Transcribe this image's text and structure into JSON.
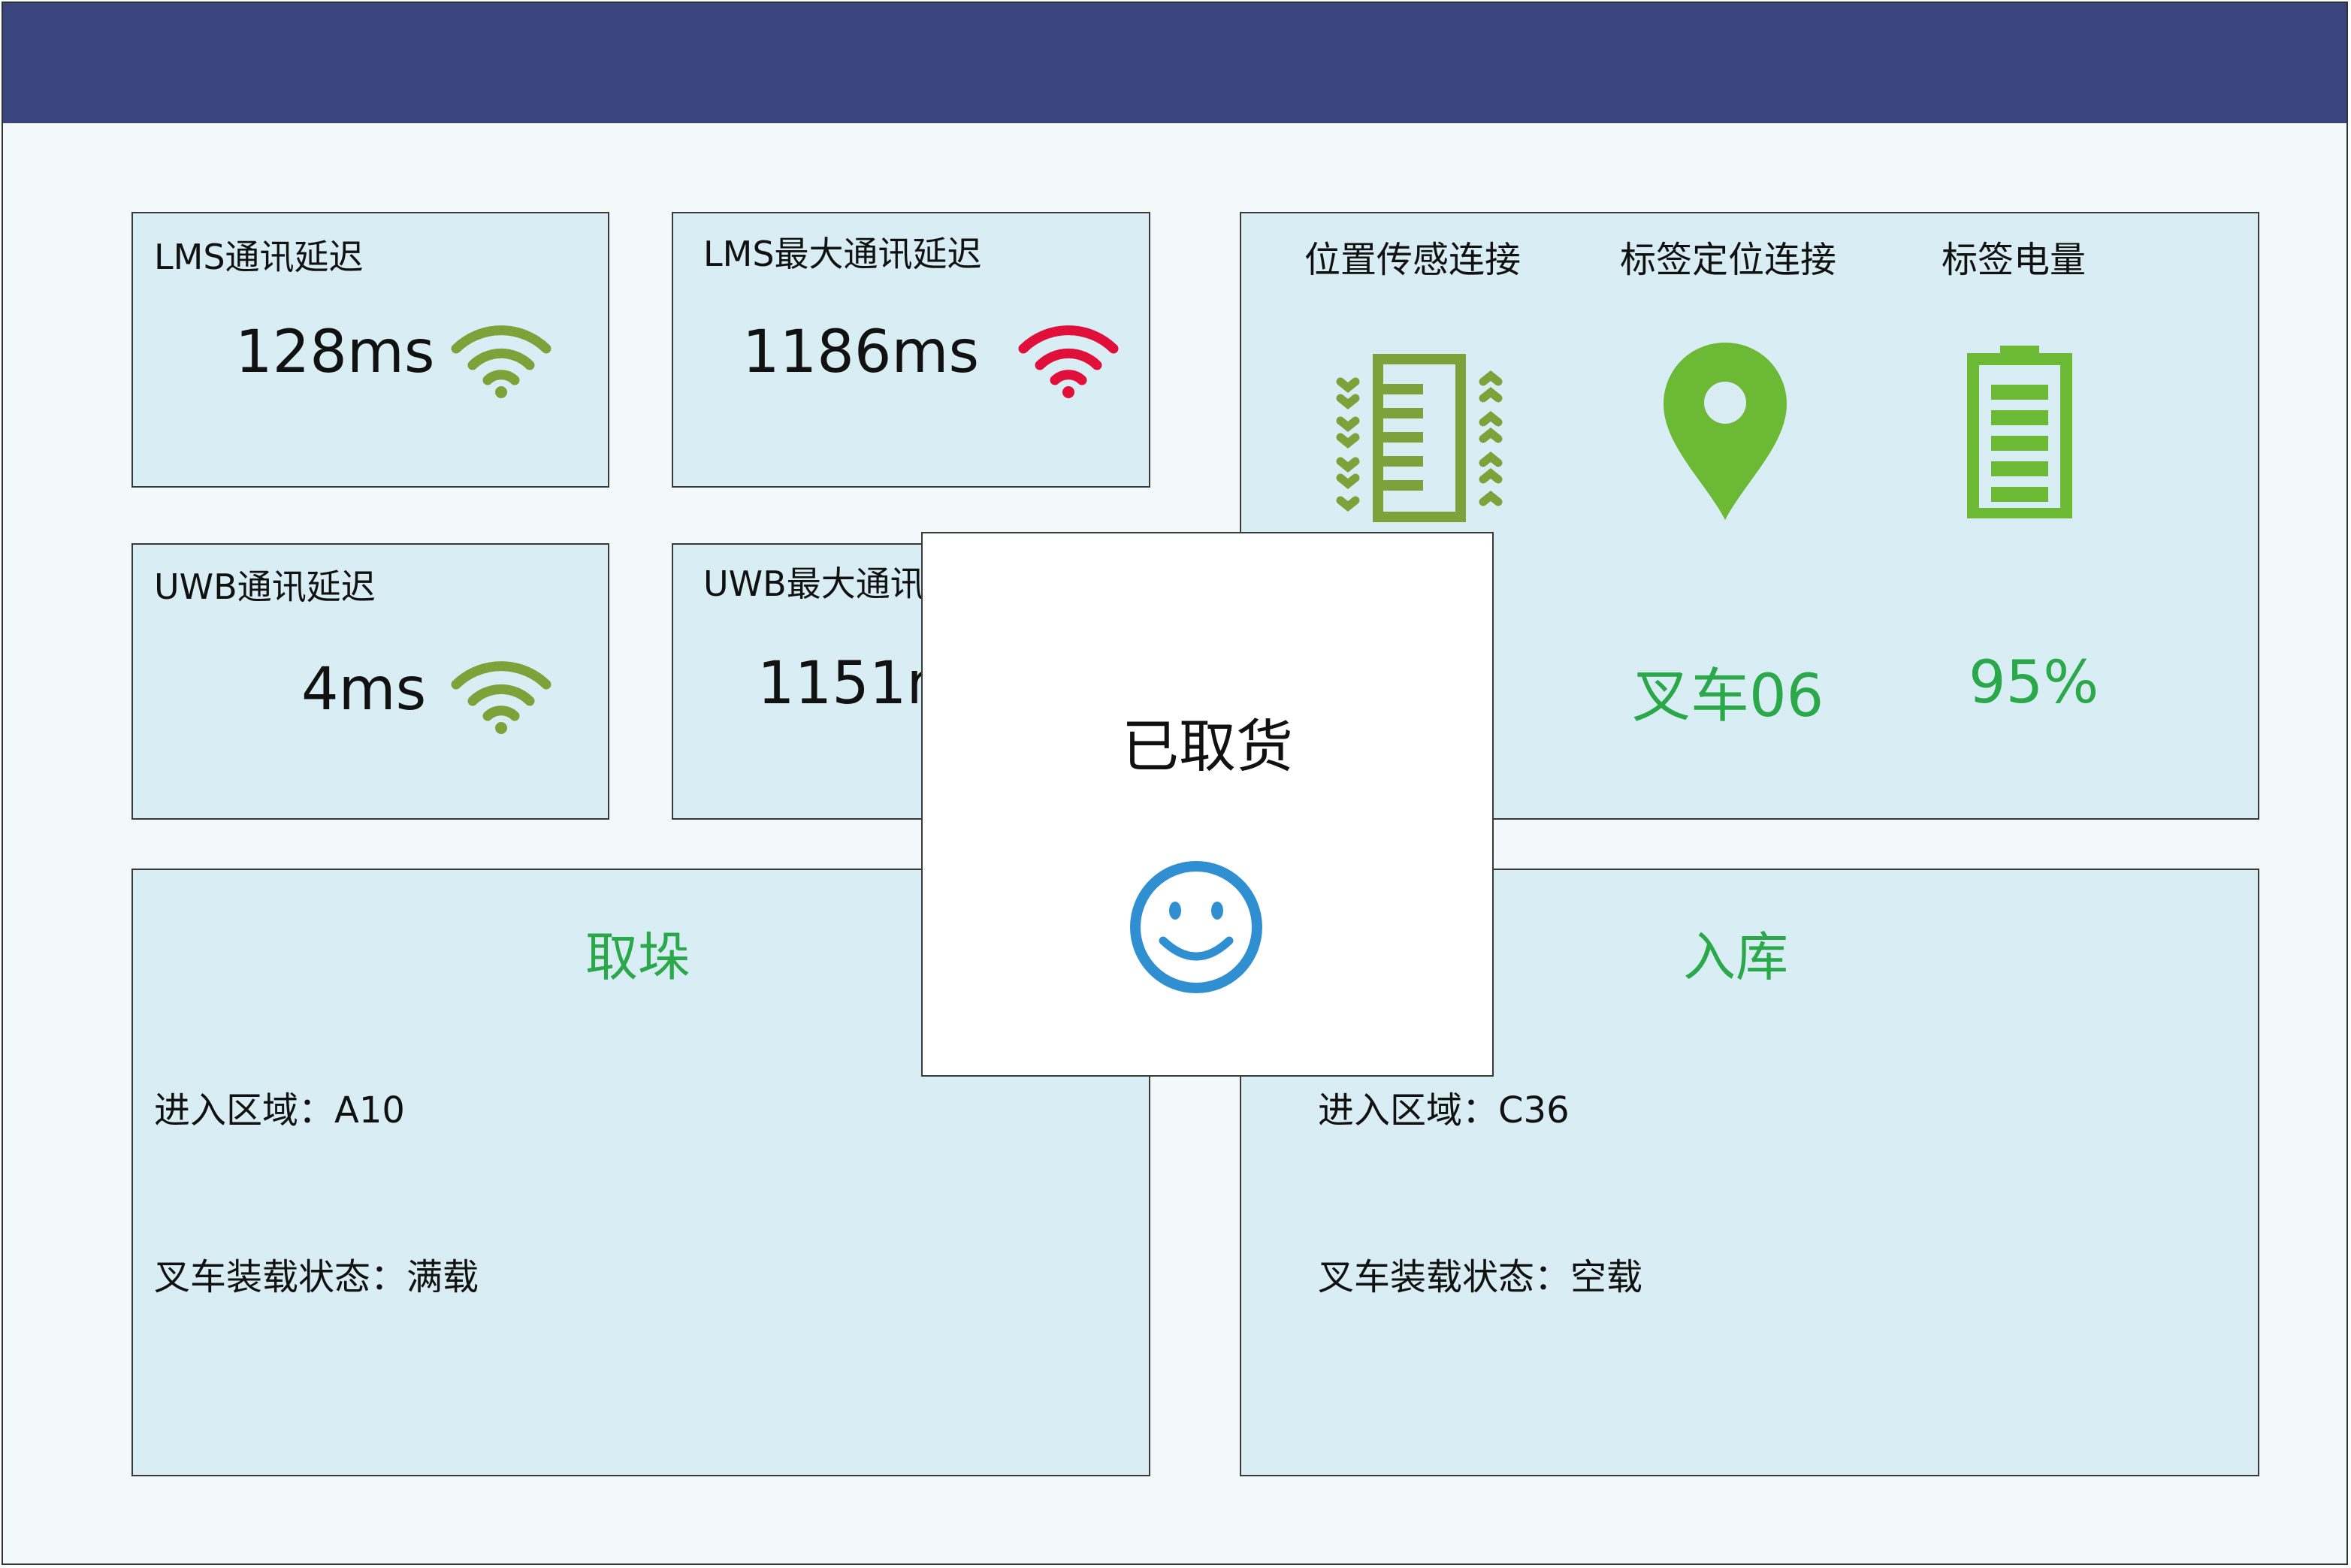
{
  "colors": {
    "header": "#3a4580",
    "card_bg": "#d8edf4",
    "wifi_good": "#7da23a",
    "wifi_bad": "#e0103a",
    "sensor_olive": "#7da23a",
    "location_green": "#6bb934",
    "accent_green": "#2aa84a",
    "smile_blue": "#2f8fd0"
  },
  "metrics": {
    "lms_latency": {
      "label": "LMS通讯延迟",
      "value": "128ms",
      "icon": "wifi-good-icon"
    },
    "lms_max_latency": {
      "label": "LMS最大通讯延迟",
      "value": "1186ms",
      "icon": "wifi-bad-icon"
    },
    "uwb_latency": {
      "label": "UWB通讯延迟",
      "value": "4ms",
      "icon": "wifi-good-icon"
    },
    "uwb_max_latency": {
      "label": "UWB最大通讯延迟",
      "value": "1151ms"
    }
  },
  "status_panel": {
    "position_sensor": {
      "label": "位置传感连接",
      "icon": "sensor-icon"
    },
    "tag_location": {
      "label": "标签定位连接",
      "icon": "location-pin-icon",
      "value": "叉车06"
    },
    "tag_battery": {
      "label": "标签电量",
      "icon": "battery-icon",
      "value": "95%"
    }
  },
  "pickup_panel": {
    "title": "取垛",
    "zone_label": "进入区域：",
    "zone_value": "A10",
    "load_label": "叉车装载状态：",
    "load_value": "满载"
  },
  "storage_panel": {
    "title": "入库",
    "zone_label": "进入区域：",
    "zone_value": "C36",
    "load_label": "叉车装载状态：",
    "load_value": "空载"
  },
  "popup": {
    "message": "已取货",
    "icon": "smiley-icon"
  }
}
